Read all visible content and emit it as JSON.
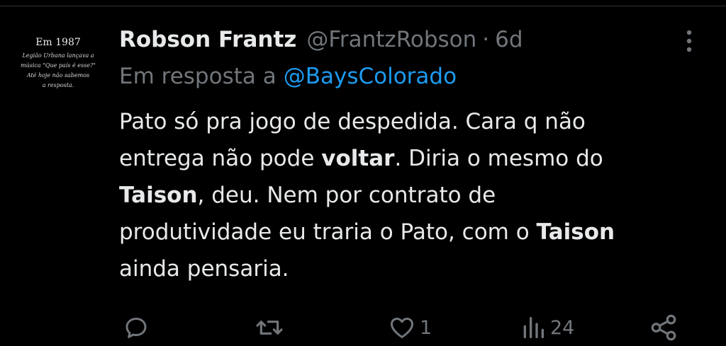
{
  "avatar": {
    "lines": [
      "Em 1987",
      "Legião Urbana lançava a",
      "música \"Que país é esse?\"",
      "Até hoje não sabemos",
      "a resposta."
    ]
  },
  "tweet": {
    "display_name": "Robson Frantz",
    "handle": "@FrantzRobson",
    "separator": "·",
    "time": "6d",
    "reply_prefix": "Em resposta a",
    "reply_mention": "@BaysColorado",
    "body": {
      "l1": "Pato só pra jogo de despedida. Cara q não",
      "l2a": "entrega não pode ",
      "l2b": "voltar",
      "l2c": ". Diria o mesmo do",
      "l3a": "Taison",
      "l3b": ", deu. Nem por contrato de",
      "l4a": "produtividade eu traria o Pato, com o ",
      "l4b": "Taison",
      "l5": "ainda pensaria."
    }
  },
  "actions": {
    "reply_count": "",
    "retweet_count": "",
    "like_count": "1",
    "views_count": "24"
  },
  "colors": {
    "background": "#000000",
    "text": "#e7e9ea",
    "muted": "#71767b",
    "link": "#1d9bf0"
  }
}
